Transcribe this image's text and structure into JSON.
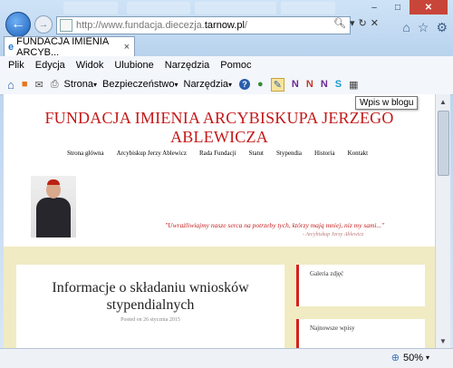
{
  "browser": {
    "address_prefix": "http://www.fundacja.diecezja.",
    "address_host": "tarnow.pl",
    "address_suffix": "/",
    "tab_title": "FUNDACJA IMIENIA ARCYB...",
    "back_icon": "←",
    "forward_icon": "→",
    "tab_close": "×",
    "window_minimize": "–",
    "window_maximize": "□",
    "window_close": "✕"
  },
  "menubar": {
    "items": [
      "Plik",
      "Edycja",
      "Widok",
      "Ulubione",
      "Narzędzia",
      "Pomoc"
    ]
  },
  "commandbar": {
    "page": "Strona",
    "security": "Bezpieczeństwo",
    "tools": "Narzędzia",
    "tooltip": "Wpis w blogu"
  },
  "site": {
    "title": "FUNDACJA IMIENIA ARCYBISKUPA JERZEGO ABLEWICZA",
    "nav": [
      "Strona główna",
      "Arcybiskup Jerzy Ablewicz",
      "Rada Fundacji",
      "Statut",
      "Stypendia",
      "Historia",
      "Kontakt"
    ],
    "quote": "\"Uwrażliwiajmy nasze serca na potrzeby tych, którzy mają mniej, niz my sami...\"",
    "signature": "- Arcybiskup Jerzy Ablewicz",
    "post": {
      "title": "Informacje o składaniu wniosków stypendialnych",
      "date": "Posted on 26 stycznia 2015"
    },
    "widgets": [
      "Galeria zdjęć",
      "Najnowsze wpisy"
    ]
  },
  "status": {
    "zoom": "50%"
  }
}
